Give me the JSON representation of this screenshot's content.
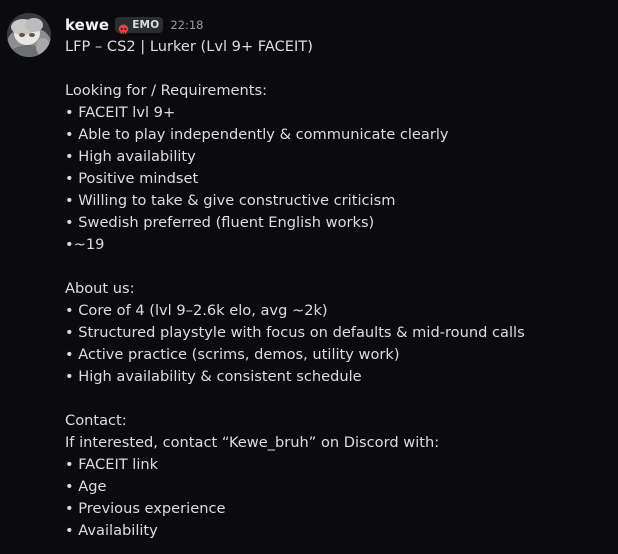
{
  "message": {
    "author": {
      "username": "kewe",
      "tag": {
        "icon": "skull-icon",
        "label": "EMO",
        "icon_color": "#f23f43"
      },
      "timestamp": "22:18"
    },
    "lines": [
      "LFP – CS2 | Lurker (Lvl 9+ FACEIT)",
      "",
      "Looking for / Requirements:",
      "• FACEIT lvl 9+",
      "• Able to play independently & communicate clearly",
      "• High availability",
      "• Positive mindset",
      "• Willing to take & give constructive criticism",
      "• Swedish preferred (fluent English works)",
      "•~19",
      "",
      "About us:",
      "• Core of 4 (lvl 9–2.6k elo, avg ~2k)",
      "• Structured playstyle with focus on defaults & mid-round calls",
      "• Active practice (scrims, demos, utility work)",
      "• High availability & consistent schedule",
      "",
      "Contact:",
      "If interested, contact “Kewe_bruh” on Discord with:",
      "• FACEIT link",
      "• Age",
      "• Previous experience",
      "• Availability"
    ]
  },
  "colors": {
    "background": "#0b0b0d",
    "text": "#dbdee1",
    "username": "#f2f3f5",
    "timestamp": "#949ba4"
  }
}
